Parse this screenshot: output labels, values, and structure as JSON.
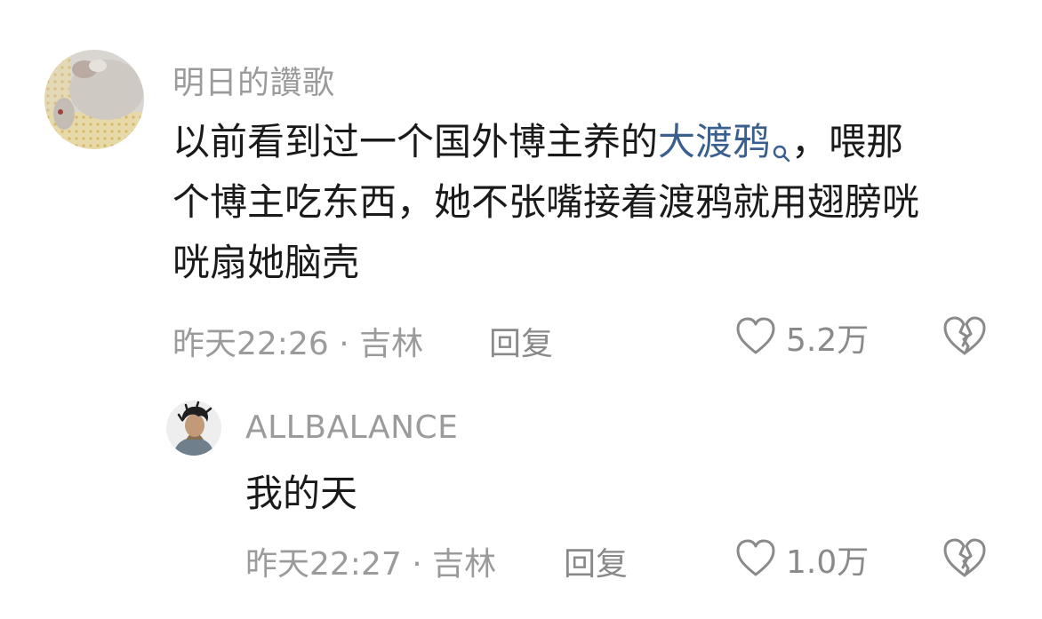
{
  "comments": [
    {
      "username": "明日的讚歌",
      "content": {
        "line1_before": "以前看到过一个国外博主养的",
        "line1_link": "大渡鸦",
        "line1_after": "，喂那",
        "line2": "个博主吃东西，她不张嘴接着渡鸦就用翅膀咣",
        "line3": "咣扇她脑壳"
      },
      "time_location": "昨天22:26 · 吉林",
      "reply_label": "回复",
      "like_count": "5.2万",
      "icons": {
        "link": "search-icon",
        "like": "heart-outline-icon",
        "dislike": "broken-heart-icon"
      }
    }
  ],
  "replies": [
    {
      "username": "ALLBALANCE",
      "content": "我的天",
      "time_location": "昨天22:27 · 吉林",
      "reply_label": "回复",
      "like_count": "1.0万",
      "icons": {
        "like": "heart-outline-icon",
        "dislike": "broken-heart-icon"
      }
    }
  ],
  "colors": {
    "link": "#3a5f8f",
    "meta": "#9b9b9b",
    "text": "#1a1a1a"
  }
}
